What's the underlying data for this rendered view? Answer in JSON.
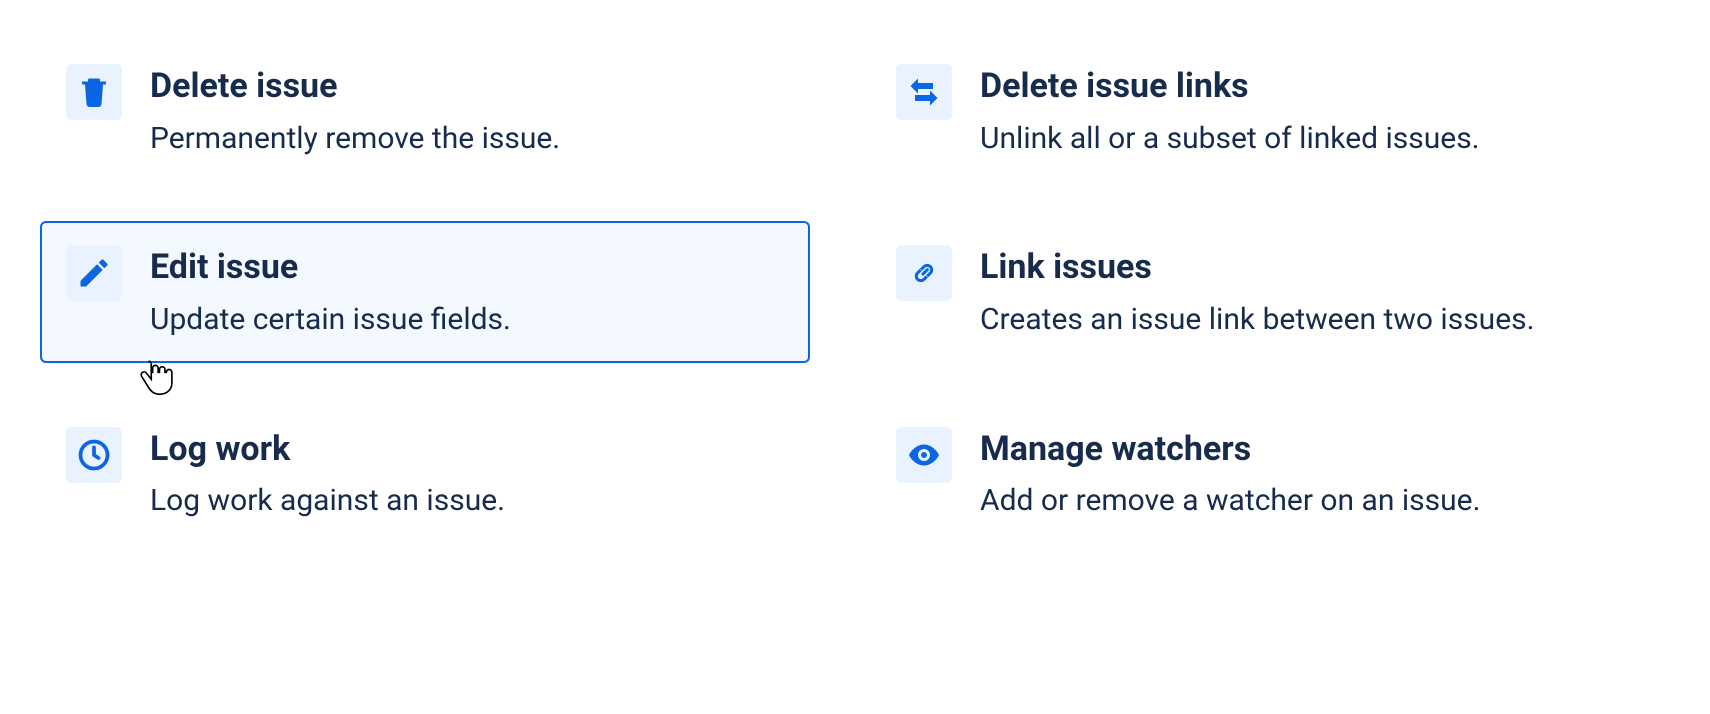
{
  "actions": {
    "delete_issue": {
      "title": "Delete issue",
      "desc": "Permanently remove the issue."
    },
    "delete_issue_links": {
      "title": "Delete issue links",
      "desc": "Unlink all or a subset of linked issues."
    },
    "edit_issue": {
      "title": "Edit issue",
      "desc": "Update certain issue fields."
    },
    "link_issues": {
      "title": "Link issues",
      "desc": "Creates an issue link between two issues."
    },
    "log_work": {
      "title": "Log work",
      "desc": "Log work against an issue."
    },
    "manage_watchers": {
      "title": "Manage watchers",
      "desc": "Add or remove a watcher on an issue."
    }
  }
}
